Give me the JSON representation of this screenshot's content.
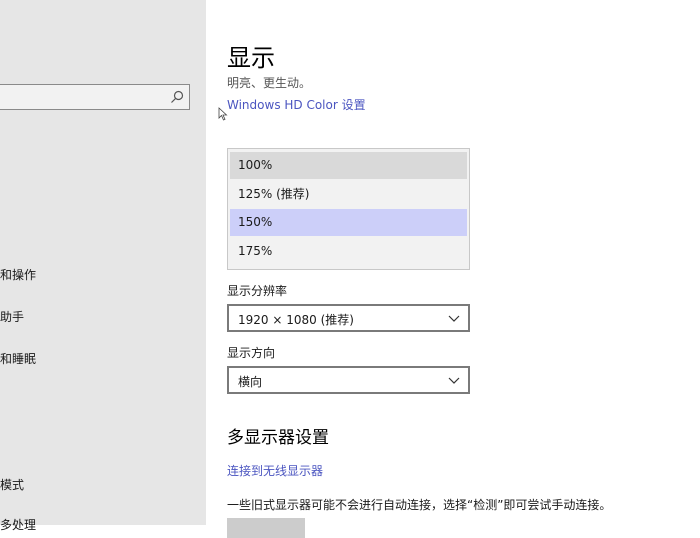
{
  "sidebar": {
    "search": {
      "value": "",
      "icon": "search-icon"
    },
    "items": [
      {
        "label": "和操作"
      },
      {
        "label": "助手"
      },
      {
        "label": "和睡眠"
      },
      {
        "label": "模式"
      },
      {
        "label": "多处理"
      }
    ]
  },
  "main": {
    "title": "显示",
    "subtitle": "明亮、更生动。",
    "hdr_link": "Windows HD Color 设置",
    "scale_dropdown": {
      "options": [
        "100%",
        "125% (推荐)",
        "150%",
        "175%"
      ],
      "current": "100%",
      "hovered": "150%"
    },
    "resolution": {
      "label": "显示分辨率",
      "value": "1920 × 1080 (推荐)"
    },
    "orientation": {
      "label": "显示方向",
      "value": "横向"
    },
    "multi_display": {
      "title": "多显示器设置",
      "wireless_link": "连接到无线显示器",
      "note": "一些旧式显示器可能不会进行自动连接，选择“检测”即可尝试手动连接。"
    }
  },
  "colors": {
    "accent": "#4b55c0",
    "sidebar_bg": "#e6e6e6",
    "hover_option": "#cccff9"
  }
}
